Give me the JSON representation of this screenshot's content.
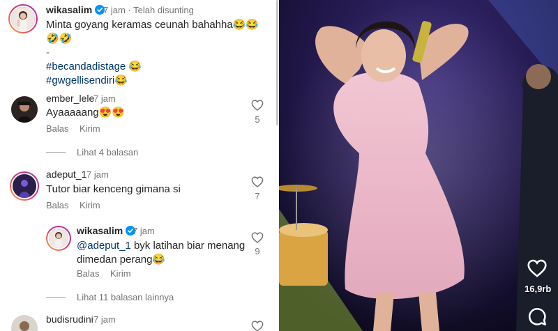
{
  "caption": {
    "username": "wikasalim",
    "time": "7 jam",
    "separator": "·",
    "edited": "Telah disunting",
    "text_line1": "Minta goyang keramas ceunah bahahha😂😂",
    "text_line2": "🤣🤣",
    "dash": "-",
    "hashtag1": "#becandadistage 😂",
    "hashtag2": "#gwgellisendiri😂"
  },
  "comments": [
    {
      "username": "ember_lele",
      "time": "7 jam",
      "text": "Ayaaaaang😍😍",
      "reply_label": "Balas",
      "send_label": "Kirim",
      "likes": "5",
      "view_replies": "Lihat 4 balasan"
    },
    {
      "username": "adeput_1",
      "time": "7 jam",
      "text": "Tutor biar kenceng gimana si",
      "reply_label": "Balas",
      "send_label": "Kirim",
      "likes": "7"
    },
    {
      "username": "budisrudini",
      "time": "7 jam"
    }
  ],
  "reply": {
    "username": "wikasalim",
    "time": "7 jam",
    "mention": "@adeput_1",
    "text_line1": " byk latihan biar menang",
    "text_line2": "dimedan perang😂",
    "reply_label": "Balas",
    "send_label": "Kirim",
    "likes": "9",
    "view_more": "Lihat 11 balasan lainnya"
  },
  "video": {
    "like_count": "16,9rb",
    "icons": [
      "heart-icon",
      "comment-icon"
    ]
  },
  "colors": {
    "link": "#00376b",
    "muted": "#737373",
    "verified": "#0095f6"
  }
}
